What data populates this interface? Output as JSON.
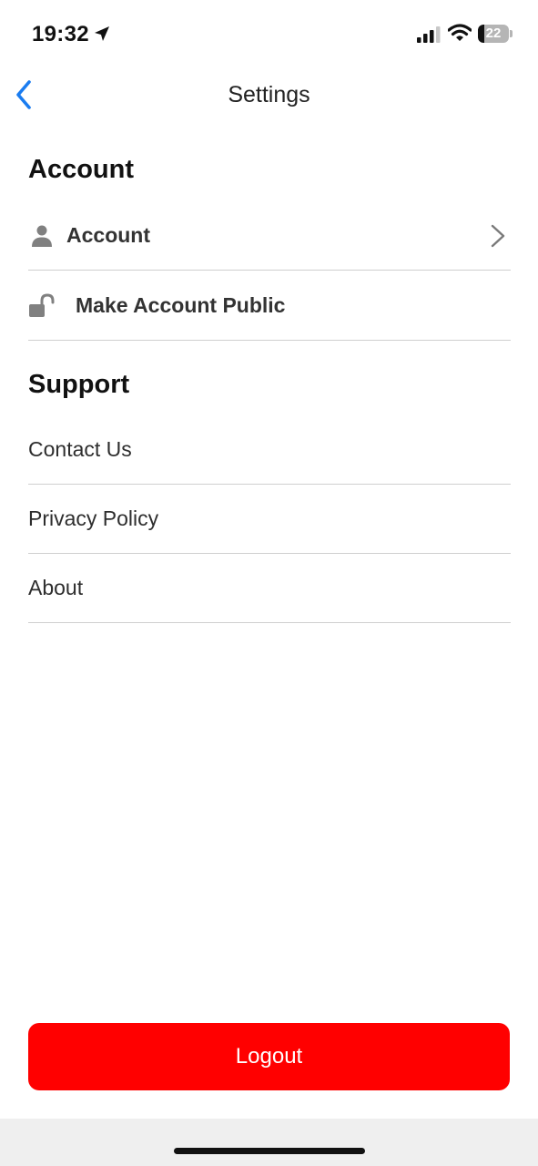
{
  "status_bar": {
    "time": "19:32",
    "battery_level": "22",
    "battery_fraction": 0.22
  },
  "nav": {
    "title": "Settings",
    "back_icon": "chevron-left-icon",
    "accent_color": "#1a7cf0"
  },
  "account_section": {
    "header": "Account",
    "items": [
      {
        "label": "Account",
        "icon": "person-icon",
        "has_chevron": true
      },
      {
        "label": "Make Account Public",
        "icon": "unlocked-padlock-icon",
        "has_chevron": false
      }
    ]
  },
  "support_section": {
    "header": "Support",
    "items": [
      {
        "label": "Contact Us"
      },
      {
        "label": "Privacy Policy"
      },
      {
        "label": "About"
      }
    ]
  },
  "logout": {
    "label": "Logout",
    "color": "#ff0000"
  }
}
